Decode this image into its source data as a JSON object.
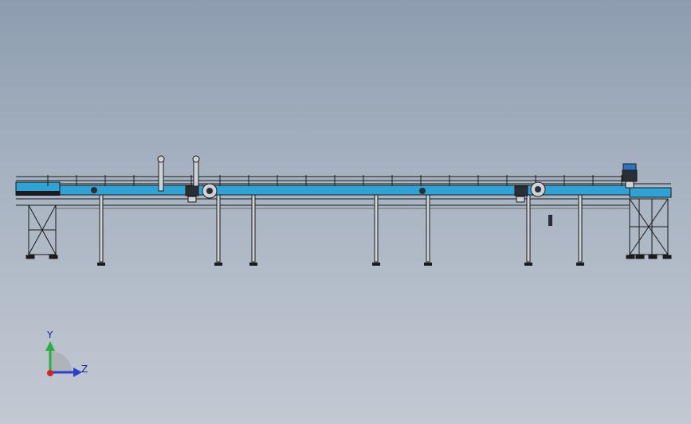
{
  "colors": {
    "background_top": "#8d9db0",
    "background_bottom": "#c3c9d3",
    "conveyor_body": "#2fa3d6",
    "frame_line": "#1b1b1b",
    "leg_fill": "#cfd3d8",
    "motor_dark": "#2a2f36",
    "motor_blue": "#2c73c4",
    "axis_y": "#22b33a",
    "axis_z": "#2b3fd1",
    "axis_origin": "#d52222"
  },
  "icons": {
    "triad": "coordinate-triad-icon"
  },
  "axes": {
    "y_label": "Y",
    "z_label": "Z"
  }
}
